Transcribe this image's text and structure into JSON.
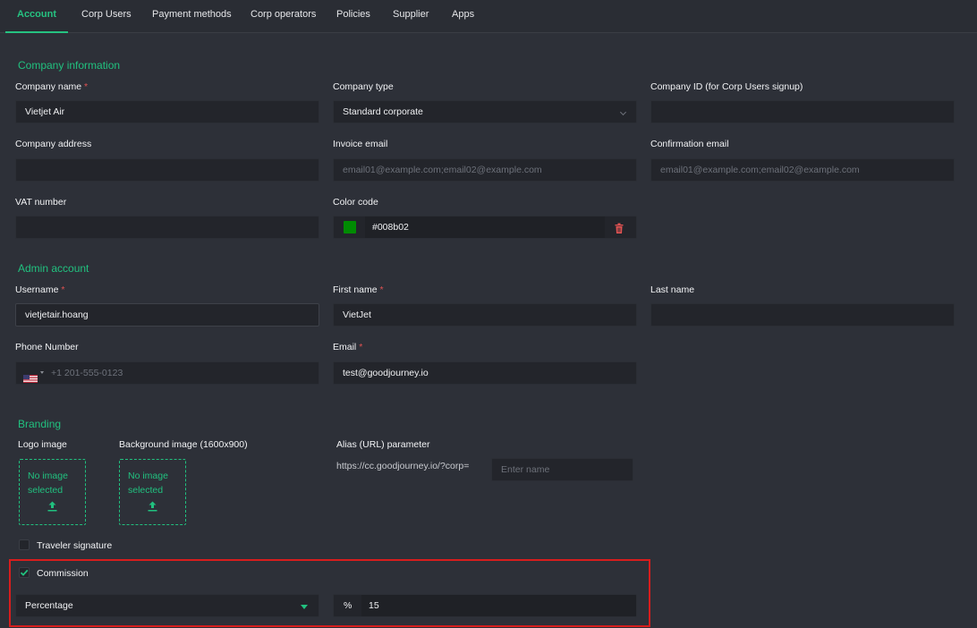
{
  "tabs": [
    {
      "label": "Account"
    },
    {
      "label": "Corp Users"
    },
    {
      "label": "Payment methods"
    },
    {
      "label": "Corp operators"
    },
    {
      "label": "Policies"
    },
    {
      "label": "Supplier"
    },
    {
      "label": "Apps"
    }
  ],
  "company": {
    "title": "Company information",
    "name_label": "Company name",
    "name_value": "Vietjet Air",
    "type_label": "Company type",
    "type_value": "Standard corporate",
    "id_label": "Company ID (for Corp Users signup)",
    "id_value": "",
    "address_label": "Company address",
    "address_value": "",
    "invoice_label": "Invoice email",
    "invoice_placeholder": "email01@example.com;email02@example.com",
    "confirm_label": "Confirmation email",
    "confirm_placeholder": "email01@example.com;email02@example.com",
    "vat_label": "VAT number",
    "vat_value": "",
    "color_label": "Color code",
    "color_value": "#008b02",
    "swatch_color": "#008b02"
  },
  "admin": {
    "title": "Admin account",
    "username_label": "Username",
    "username_value": "vietjetair.hoang",
    "firstname_label": "First name",
    "firstname_value": "VietJet",
    "lastname_label": "Last name",
    "lastname_value": "",
    "phone_label": "Phone Number",
    "phone_placeholder": "+1 201-555-0123",
    "email_label": "Email",
    "email_value": "test@goodjourney.io"
  },
  "branding": {
    "title": "Branding",
    "logo_label": "Logo image",
    "logo_empty_line1": "No image",
    "logo_empty_line2": "selected",
    "bg_label": "Background image (1600x900)",
    "bg_empty_line1": "No image",
    "bg_empty_line2": "selected",
    "alias_label": "Alias (URL) parameter",
    "alias_prefix": "https://cc.goodjourney.io/?corp=",
    "alias_placeholder": "Enter name",
    "traveler_signature_label": "Traveler signature",
    "traveler_signature_checked": false,
    "commission_label": "Commission",
    "commission_checked": true,
    "commission_type": "Percentage",
    "commission_unit": "%",
    "commission_value": "15"
  },
  "required_mark": "*",
  "colors": {
    "accent": "#21c17f",
    "background": "#2d3038",
    "field": "#23252b",
    "danger": "#d81d1d"
  }
}
